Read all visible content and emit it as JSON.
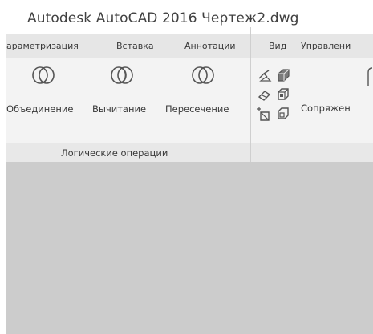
{
  "app": {
    "title": "Autodesk AutoCAD 2016    Чертеж2.dwg"
  },
  "tabs": [
    {
      "label": "араметризация"
    },
    {
      "label": "Вставка"
    },
    {
      "label": "Аннотации"
    },
    {
      "label": "Вид"
    },
    {
      "label": "Управлени"
    }
  ],
  "ribbon": {
    "tools": [
      {
        "label": "Объединение",
        "icon": "union-icon"
      },
      {
        "label": "Вычитание",
        "icon": "subtract-icon"
      },
      {
        "label": "Пересечение",
        "icon": "intersect-icon"
      }
    ],
    "panel_label": "Логические операции",
    "small_tools": [
      {
        "icon": "extract-edges-icon"
      },
      {
        "icon": "extrude-face-icon"
      },
      {
        "icon": "eraser-icon"
      },
      {
        "icon": "solid-box-icon"
      },
      {
        "icon": "slice-icon"
      },
      {
        "icon": "shell-icon"
      }
    ],
    "fillet_label": "Сопряжен"
  },
  "colors": {
    "ribbon_bg": "#f3f3f3",
    "tab_bg": "#e6e6e6",
    "workspace_bg": "#cccccc",
    "icon_stroke": "#555555"
  }
}
